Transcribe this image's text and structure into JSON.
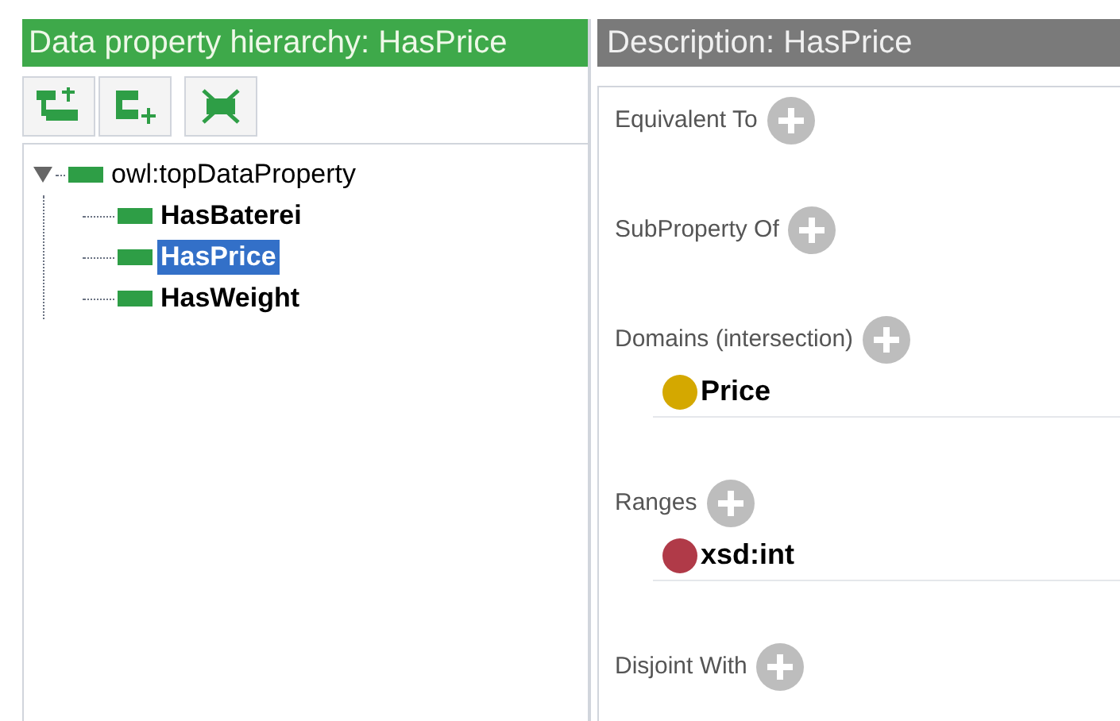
{
  "hierarchy_panel": {
    "title": "Data property hierarchy: HasPrice"
  },
  "tree": [
    {
      "label": "owl:topDataProperty",
      "expanded": true,
      "selected": false,
      "children": [
        {
          "label": "HasBaterei",
          "selected": false
        },
        {
          "label": "HasPrice",
          "selected": true
        },
        {
          "label": "HasWeight",
          "selected": false
        }
      ]
    }
  ],
  "description_panel": {
    "title": "Description: HasPrice"
  },
  "sections": [
    {
      "label": "Equivalent To"
    },
    {
      "label": "SubProperty Of"
    },
    {
      "label": "Domains (intersection)",
      "items": [
        {
          "label": "Price",
          "color": "#d4a800"
        }
      ]
    },
    {
      "label": "Ranges",
      "items": [
        {
          "label": "xsd:int",
          "color": "#b03a48"
        }
      ]
    },
    {
      "label": "Disjoint With"
    }
  ]
}
